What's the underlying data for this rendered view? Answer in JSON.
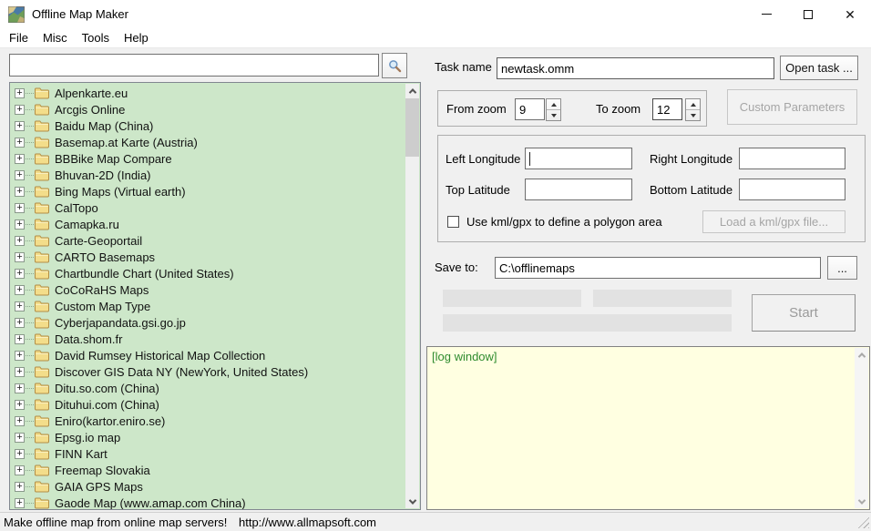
{
  "window": {
    "title": "Offline Map Maker"
  },
  "menu": {
    "items": [
      "File",
      "Misc",
      "Tools",
      "Help"
    ]
  },
  "search": {
    "value": ""
  },
  "map_list": {
    "items": [
      "Alpenkarte.eu",
      "Arcgis Online",
      "Baidu Map (China)",
      "Basemap.at Karte (Austria)",
      "BBBike Map Compare",
      "Bhuvan-2D (India)",
      "Bing Maps (Virtual earth)",
      "CalTopo",
      "Camapka.ru",
      "Carte-Geoportail",
      "CARTO Basemaps",
      "Chartbundle Chart (United States)",
      "CoCoRaHS Maps",
      "Custom Map Type",
      "Cyberjapandata.gsi.go.jp",
      "Data.shom.fr",
      "David Rumsey Historical Map Collection",
      "Discover GIS Data NY (NewYork, United States)",
      "Ditu.so.com (China)",
      "Dituhui.com (China)",
      "Eniro(kartor.eniro.se)",
      "Epsg.io map",
      "FINN Kart",
      "Freemap Slovakia",
      "GAIA GPS Maps",
      "Gaode Map (www.amap.com China)"
    ]
  },
  "task": {
    "label": "Task name",
    "value": "newtask.omm",
    "open_button": "Open task ..."
  },
  "zoom": {
    "from_label": "From zoom",
    "from_value": "9",
    "to_label": "To zoom",
    "to_value": "12"
  },
  "custom_parameters_button": "Custom Parameters",
  "area": {
    "left_longitude_label": "Left Longitude",
    "left_longitude_value": "",
    "right_longitude_label": "Right Longitude",
    "right_longitude_value": "",
    "top_latitude_label": "Top Latitude",
    "top_latitude_value": "",
    "bottom_latitude_label": "Bottom Latitude",
    "bottom_latitude_value": "",
    "kml_checkbox_label": "Use kml/gpx to define a polygon area",
    "kml_checked": false,
    "load_kml_button": "Load a kml/gpx file..."
  },
  "save": {
    "label": "Save to:",
    "path": "C:\\offlinemaps",
    "browse_button": "..."
  },
  "start_button": "Start",
  "log": {
    "content": "[log window]"
  },
  "status_bar": {
    "message": "Make offline map from online map servers!",
    "url": "http://www.allmapsoft.com"
  },
  "colors": {
    "tree_background": "#cde7c9",
    "log_background": "#ffffe1",
    "log_text": "#2e8b2e",
    "window_background": "#f0f0f0",
    "titlebar_background": "#ffffff",
    "folder_yellow": "#f3dd8a"
  }
}
